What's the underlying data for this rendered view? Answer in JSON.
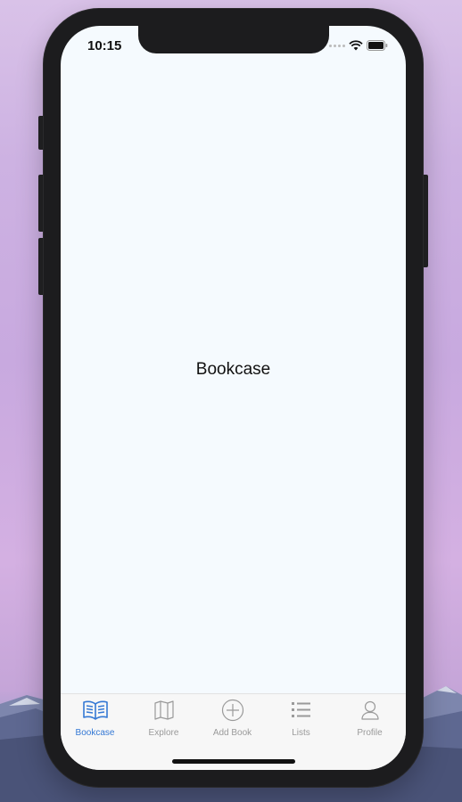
{
  "status_bar": {
    "time": "10:15",
    "icons": [
      "signal-icon",
      "wifi-icon",
      "battery-icon"
    ]
  },
  "screen": {
    "title": "Bookcase"
  },
  "tab_bar": {
    "active_color": "#3478d4",
    "inactive_color": "#9a9a9a",
    "tabs": [
      {
        "label": "Bookcase",
        "icon": "open-book-icon",
        "active": true
      },
      {
        "label": "Explore",
        "icon": "map-icon",
        "active": false
      },
      {
        "label": "Add Book",
        "icon": "plus-circle-icon",
        "active": false
      },
      {
        "label": "Lists",
        "icon": "list-icon",
        "active": false
      },
      {
        "label": "Profile",
        "icon": "person-icon",
        "active": false
      }
    ]
  }
}
